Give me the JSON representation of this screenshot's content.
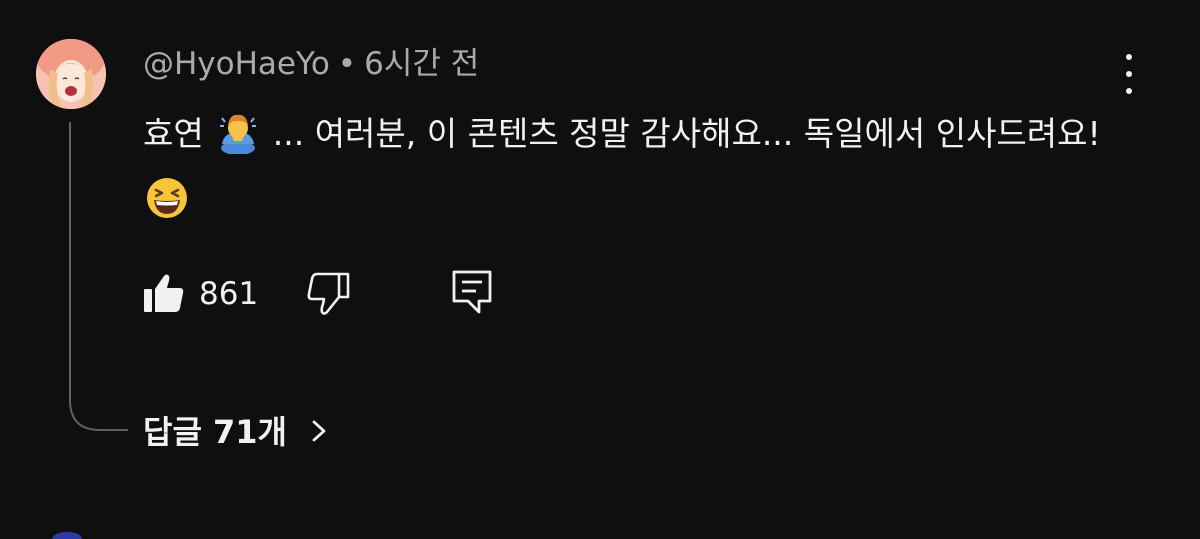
{
  "comment": {
    "author": "@HyoHaeYo",
    "separator": "•",
    "time": "6시간 전",
    "text_part1": "효연",
    "emoji1": "person-bowing-emoji",
    "text_part2": "... 여러분, 이 콘텐츠 정말 감사해요... 독일에서 인사드려요!",
    "emoji2": "grinning-squinting-face-emoji",
    "like_count": "861"
  },
  "replies": {
    "label": "답글 71개"
  },
  "icons": {
    "like": "thumbs-up-icon",
    "dislike": "thumbs-down-icon",
    "reply": "reply-comment-icon",
    "menu": "more-vert-icon",
    "chevron": "chevron-right-icon"
  },
  "colors": {
    "background": "#0f0f0f",
    "primary_text": "#f1f1f1",
    "secondary_text": "#aaaaaa",
    "thread_line": "#606060"
  }
}
